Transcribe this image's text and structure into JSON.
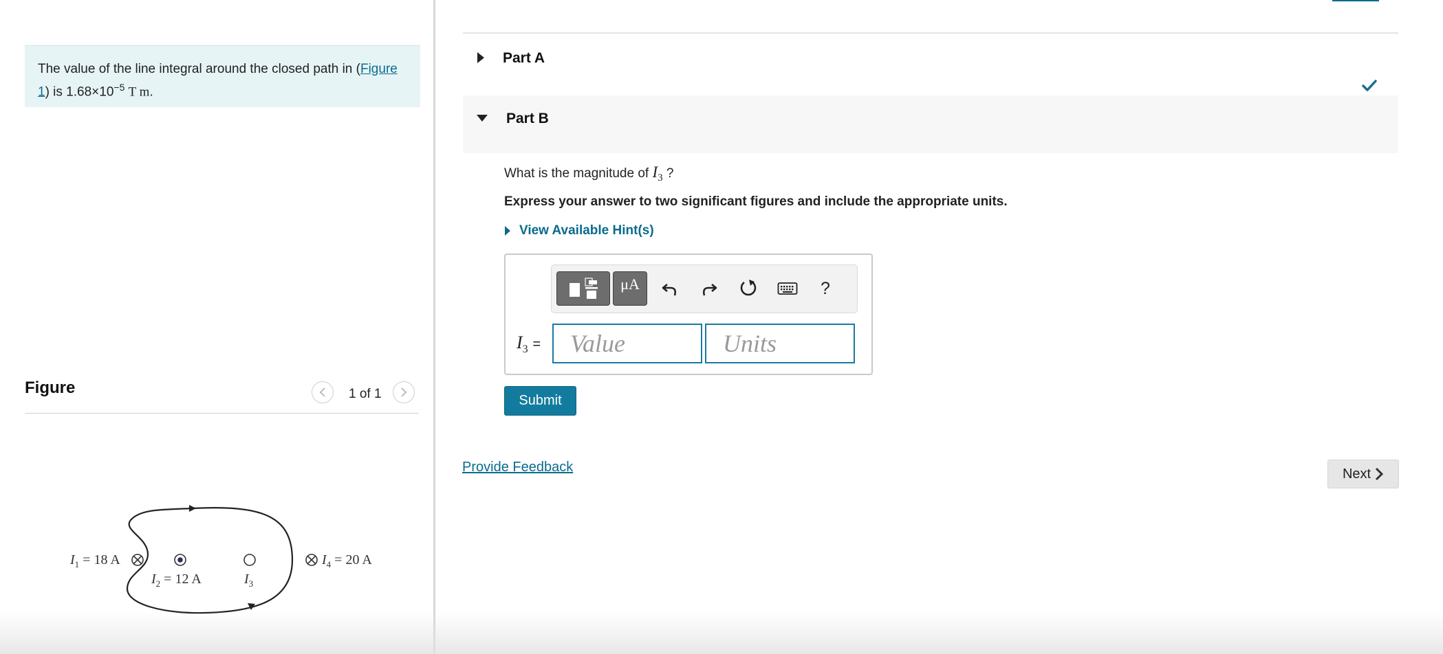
{
  "context": {
    "text_before_link": "The value of the line integral around the closed path in (",
    "figure_link": "Figure 1",
    "text_after_link": ") is 1.68×10",
    "exponent": "−5",
    "units": "T m",
    "period": "."
  },
  "figure_panel": {
    "title": "Figure",
    "pager": "1 of 1",
    "diagram": {
      "I1_label": "I",
      "I1_sub": "1",
      "I1_value": " = 18 A",
      "I2_label": "I",
      "I2_sub": "2",
      "I2_value": " = 12 A",
      "I3_label": "I",
      "I3_sub": "3",
      "I4_label": "I",
      "I4_sub": "4",
      "I4_value": " = 20 A"
    }
  },
  "parts": {
    "partA": {
      "label": "Part A"
    },
    "partB": {
      "label": "Part B"
    }
  },
  "question": {
    "prefix": "What is the magnitude of ",
    "var": "I",
    "var_sub": "3",
    "suffix": " ?",
    "instruction": "Express your answer to two significant figures and include the appropriate units.",
    "hint_label": "View Available Hint(s)"
  },
  "answer": {
    "var": "I",
    "var_sub": "3",
    "equals": "=",
    "value_placeholder": "Value",
    "units_placeholder": "Units",
    "mu_A": "μA",
    "help": "?"
  },
  "buttons": {
    "submit": "Submit",
    "feedback": "Provide Feedback",
    "next": "Next"
  },
  "colors": {
    "accent": "#137c9e",
    "link": "#0a6b8e",
    "info_bg": "#e6f4f5",
    "check": "#1a6f8e"
  }
}
